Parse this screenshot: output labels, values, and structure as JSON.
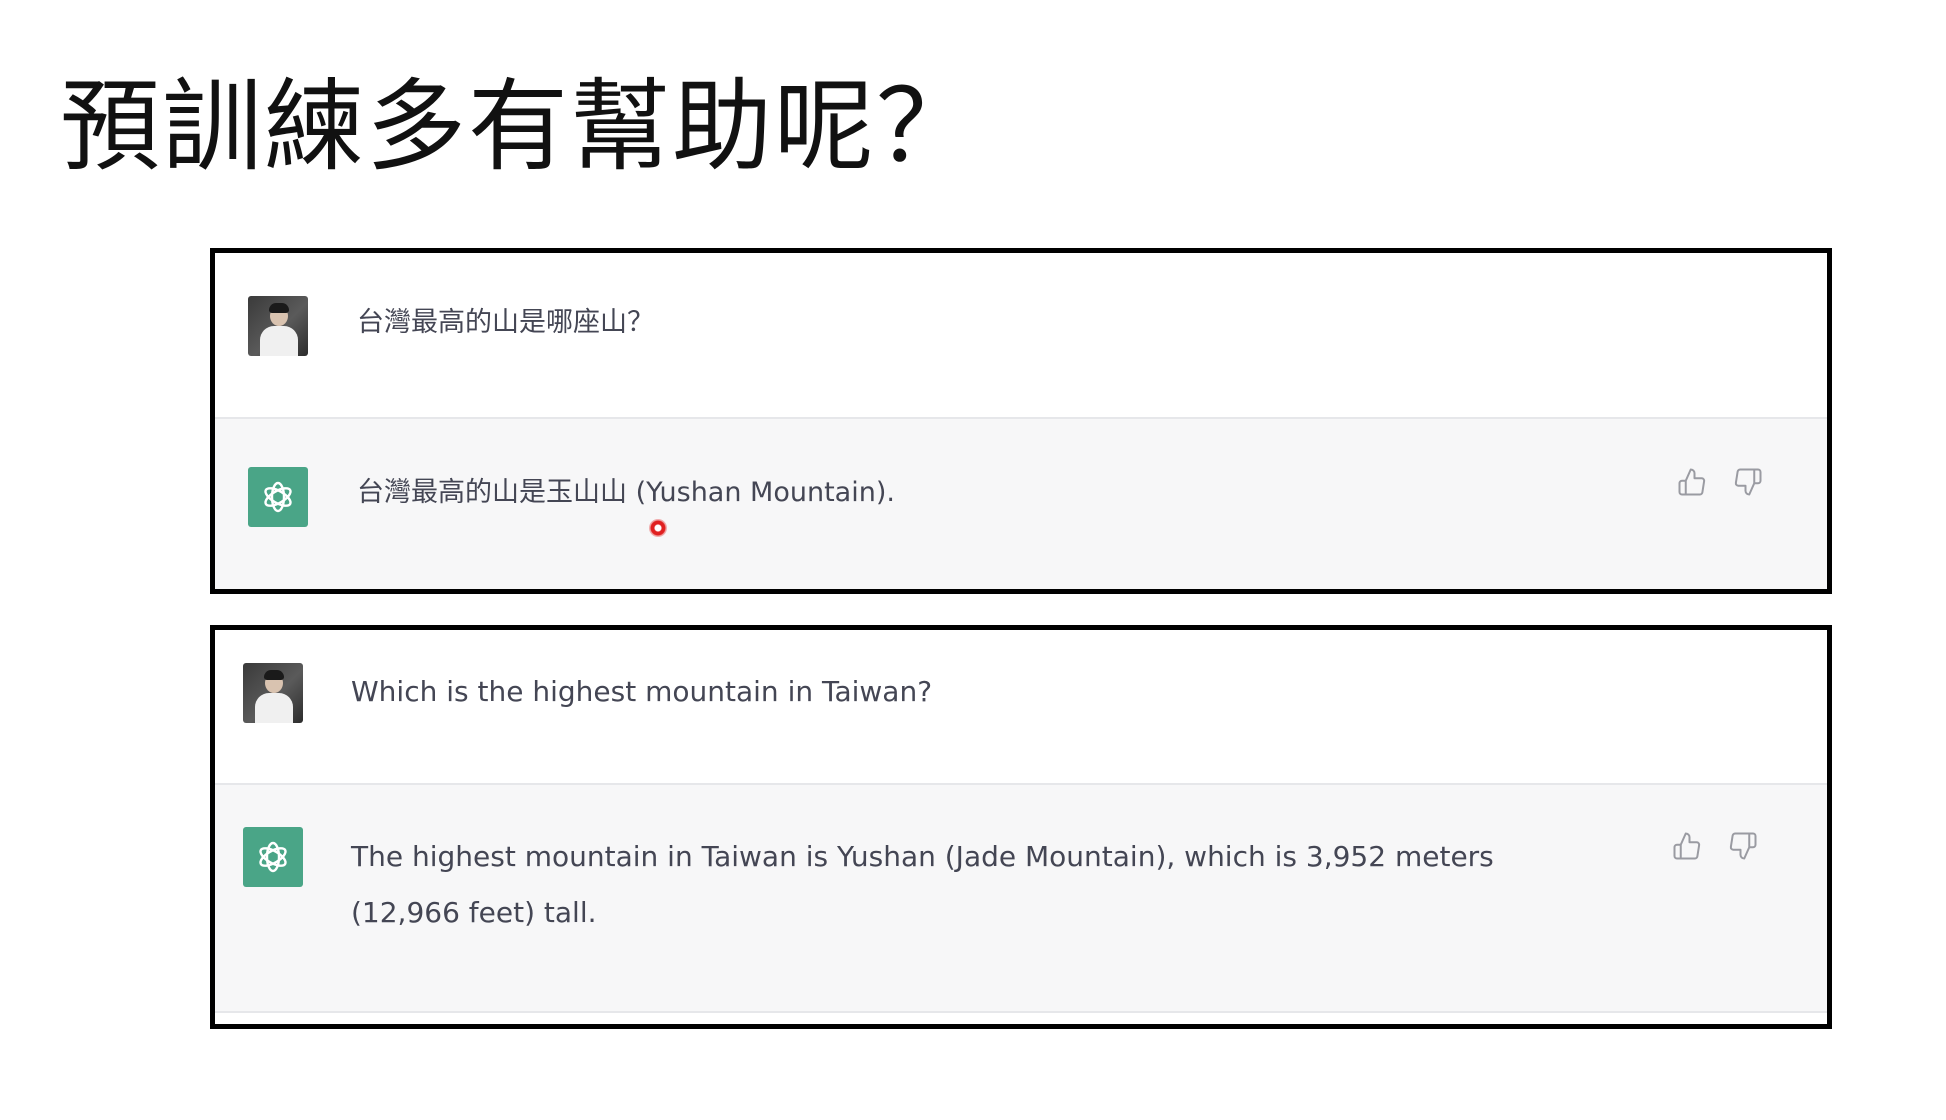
{
  "slide": {
    "title": "預訓練多有幫助呢？"
  },
  "conversations": [
    {
      "user": {
        "text": "台灣最高的山是哪座山？"
      },
      "assistant": {
        "text": "台灣最高的山是玉山山 (Yushan Mountain)."
      }
    },
    {
      "user": {
        "text": "Which is the highest mountain in Taiwan?"
      },
      "assistant": {
        "text": "The highest mountain in Taiwan is Yushan (Jade Mountain), which is 3,952 meters (12,966 feet) tall."
      }
    }
  ],
  "icons": {
    "user_avatar": "user-avatar-photo",
    "assistant_avatar": "openai-logo-icon",
    "thumbs_up": "thumbs-up-icon",
    "thumbs_down": "thumbs-down-icon",
    "cursor": "cursor-indicator"
  },
  "colors": {
    "assistant_avatar_bg": "#4aa587",
    "assistant_row_bg": "#f7f7f8",
    "message_text": "#444654",
    "frame_border": "#000000",
    "cursor": "#e02020"
  }
}
